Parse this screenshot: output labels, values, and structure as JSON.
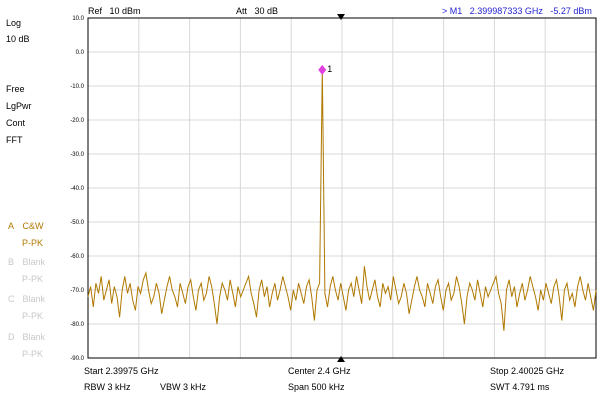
{
  "header": {
    "ref_label": "Ref",
    "ref_value": "10 dBm",
    "att_label": "Att",
    "att_value": "30 dB",
    "marker_readout": "> M1",
    "marker_freq": "2.399987333 GHz",
    "marker_level": "-5.27 dBm"
  },
  "left_panel": {
    "scale_mode": "Log",
    "scale_div": "10 dB",
    "free": "Free",
    "lgpwr": "LgPwr",
    "cont": "Cont",
    "fft": "FFT"
  },
  "traces": [
    {
      "letter": "A",
      "mode": "C&W",
      "detector": "P-PK",
      "color": "#b07800"
    },
    {
      "letter": "B",
      "mode": "Blank",
      "detector": "P-PK",
      "color": "#c8c8c8"
    },
    {
      "letter": "C",
      "mode": "Blank",
      "detector": "P-PK",
      "color": "#c8c8c8"
    },
    {
      "letter": "D",
      "mode": "Blank",
      "detector": "P-PK",
      "color": "#c8c8c8"
    }
  ],
  "footer": {
    "start": "Start  2.39975 GHz",
    "center": "Center  2.4 GHz",
    "stop": "Stop  2.40025 GHz",
    "rbw": "RBW  3 kHz",
    "vbw": "VBW  3 kHz",
    "span": "Span    500 kHz",
    "swt": "SWT  4.791 ms"
  },
  "colors": {
    "trace": "#b07800",
    "grid": "#d8d8d8",
    "marker": "#e040e0",
    "marker_text": "#1f1fd0"
  },
  "chart_data": {
    "type": "line",
    "x_start_ghz": 2.39975,
    "x_stop_ghz": 2.40025,
    "ylim": [
      -90,
      10
    ],
    "ytick_labels": [
      "10.0",
      "0.0",
      "-10.0",
      "-20.0",
      "-30.0",
      "-40.0",
      "-50.0",
      "-60.0",
      "-70.0",
      "-80.0",
      "-90.0"
    ],
    "grid": true,
    "marker": {
      "label": "1",
      "x_ghz": 2.399987333,
      "y_dbm": -5.27
    },
    "series": [
      {
        "values": [
          -72,
          -69,
          -75,
          -68,
          -71,
          -66,
          -73,
          -70,
          -67,
          -74,
          -69,
          -72,
          -78,
          -70,
          -66,
          -71,
          -68,
          -73,
          -76,
          -69,
          -71,
          -67,
          -65,
          -70,
          -74,
          -72,
          -68,
          -71,
          -77,
          -73,
          -69,
          -66,
          -70,
          -72,
          -75,
          -68,
          -71,
          -74,
          -69,
          -67,
          -72,
          -76,
          -70,
          -68,
          -73,
          -71,
          -66,
          -69,
          -74,
          -80,
          -72,
          -68,
          -70,
          -73,
          -67,
          -71,
          -75,
          -69,
          -72,
          -70,
          -68,
          -66,
          -71,
          -74,
          -78,
          -70,
          -67,
          -72,
          -69,
          -75,
          -71,
          -68,
          -73,
          -70,
          -66,
          -69,
          -72,
          -76,
          -70,
          -73,
          -68,
          -71,
          -74,
          -69,
          -67,
          -72,
          -79,
          -70,
          -68,
          -73,
          -71,
          -75,
          -69,
          -66,
          -70,
          -73,
          -68,
          -72,
          -76,
          -70,
          -68,
          -72,
          -66,
          -70,
          -74,
          -63,
          -69,
          -73,
          -70,
          -67,
          -72,
          -75,
          -68,
          -71,
          -69,
          -73,
          -66,
          -70,
          -74,
          -72,
          -68,
          -71,
          -77,
          -73,
          -69,
          -66,
          -70,
          -72,
          -75,
          -68,
          -71,
          -74,
          -69,
          -67,
          -72,
          -76,
          -70,
          -68,
          -73,
          -71,
          -66,
          -69,
          -74,
          -80,
          -72,
          -68,
          -70,
          -73,
          -67,
          -71,
          -75,
          -69,
          -72,
          -70,
          -68,
          -66,
          -71,
          -74,
          -82,
          -70,
          -67,
          -72,
          -69,
          -75,
          -71,
          -68,
          -73,
          -70,
          -66,
          -69,
          -72,
          -76,
          -70,
          -73,
          -68,
          -71,
          -74,
          -69,
          -67,
          -72,
          -79,
          -70,
          -68,
          -73,
          -71,
          -75,
          -69,
          -66,
          -70,
          -73,
          -68,
          -72,
          -76,
          -70
        ],
        "peak_index": 89
      }
    ]
  }
}
